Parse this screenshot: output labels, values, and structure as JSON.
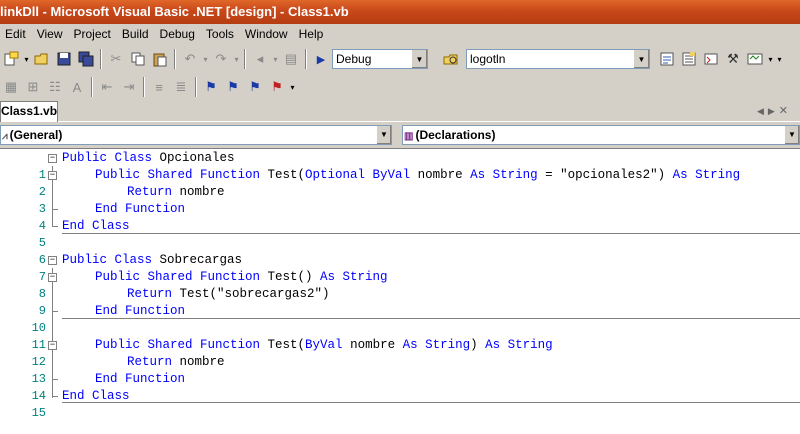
{
  "window": {
    "title": "linkDll - Microsoft Visual Basic .NET [design] - Class1.vb"
  },
  "menu": [
    "Edit",
    "View",
    "Project",
    "Build",
    "Debug",
    "Tools",
    "Window",
    "Help"
  ],
  "toolbar": {
    "config_value": "Debug",
    "find_value": "logotln"
  },
  "tab": {
    "label": "Class1.vb"
  },
  "dropdowns": {
    "class_value": "(General)",
    "method_value": "(Declarations)"
  },
  "code_lines": [
    {
      "n": "1",
      "kw1": "Public Class",
      "tx1": " Opcionales",
      "kw2": "",
      "tx2": "",
      "kw3": "",
      "tx3": "",
      "kw4": "",
      "tx4": "",
      "kw5": "",
      "tx5": "",
      "kw6": "",
      "tx6": ""
    },
    {
      "n": "2",
      "kw1": "Public Shared Function",
      "tx1": " Test(",
      "kw2": "Optional ByVal",
      "tx2": " nombre ",
      "kw3": "As String",
      "tx3": " = \"opcionales2\") ",
      "kw4": "As String",
      "tx4": "",
      "kw5": "",
      "tx5": "",
      "kw6": "",
      "tx6": ""
    },
    {
      "n": "3",
      "kw1": "Return",
      "tx1": " nombre",
      "kw2": "",
      "tx2": "",
      "kw3": "",
      "tx3": "",
      "kw4": "",
      "tx4": "",
      "kw5": "",
      "tx5": "",
      "kw6": "",
      "tx6": ""
    },
    {
      "n": "4",
      "kw1": "End Function",
      "tx1": "",
      "kw2": "",
      "tx2": "",
      "kw3": "",
      "tx3": "",
      "kw4": "",
      "tx4": "",
      "kw5": "",
      "tx5": "",
      "kw6": "",
      "tx6": ""
    },
    {
      "n": "5",
      "kw1": "End Class",
      "tx1": "",
      "kw2": "",
      "tx2": "",
      "kw3": "",
      "tx3": "",
      "kw4": "",
      "tx4": "",
      "kw5": "",
      "tx5": "",
      "kw6": "",
      "tx6": ""
    },
    {
      "n": "6",
      "kw1": "",
      "tx1": "",
      "kw2": "",
      "tx2": "",
      "kw3": "",
      "tx3": "",
      "kw4": "",
      "tx4": "",
      "kw5": "",
      "tx5": "",
      "kw6": "",
      "tx6": ""
    },
    {
      "n": "7",
      "kw1": "Public Class",
      "tx1": " Sobrecargas",
      "kw2": "",
      "tx2": "",
      "kw3": "",
      "tx3": "",
      "kw4": "",
      "tx4": "",
      "kw5": "",
      "tx5": "",
      "kw6": "",
      "tx6": ""
    },
    {
      "n": "8",
      "kw1": "Public Shared Function",
      "tx1": " Test() ",
      "kw2": "As String",
      "tx2": "",
      "kw3": "",
      "tx3": "",
      "kw4": "",
      "tx4": "",
      "kw5": "",
      "tx5": "",
      "kw6": "",
      "tx6": ""
    },
    {
      "n": "9",
      "kw1": "Return",
      "tx1": " Test(\"sobrecargas2\")",
      "kw2": "",
      "tx2": "",
      "kw3": "",
      "tx3": "",
      "kw4": "",
      "tx4": "",
      "kw5": "",
      "tx5": "",
      "kw6": "",
      "tx6": ""
    },
    {
      "n": "10",
      "kw1": "End Function",
      "tx1": "",
      "kw2": "",
      "tx2": "",
      "kw3": "",
      "tx3": "",
      "kw4": "",
      "tx4": "",
      "kw5": "",
      "tx5": "",
      "kw6": "",
      "tx6": ""
    },
    {
      "n": "11",
      "kw1": "",
      "tx1": "",
      "kw2": "",
      "tx2": "",
      "kw3": "",
      "tx3": "",
      "kw4": "",
      "tx4": "",
      "kw5": "",
      "tx5": "",
      "kw6": "",
      "tx6": ""
    },
    {
      "n": "12",
      "kw1": "Public Shared Function",
      "tx1": " Test(",
      "kw2": "ByVal",
      "tx2": " nombre ",
      "kw3": "As String",
      "tx3": ") ",
      "kw4": "As String",
      "tx4": "",
      "kw5": "",
      "tx5": "",
      "kw6": "",
      "tx6": ""
    },
    {
      "n": "13",
      "kw1": "Return",
      "tx1": " nombre",
      "kw2": "",
      "tx2": "",
      "kw3": "",
      "tx3": "",
      "kw4": "",
      "tx4": "",
      "kw5": "",
      "tx5": "",
      "kw6": "",
      "tx6": ""
    },
    {
      "n": "14",
      "kw1": "End Function",
      "tx1": "",
      "kw2": "",
      "tx2": "",
      "kw3": "",
      "tx3": "",
      "kw4": "",
      "tx4": "",
      "kw5": "",
      "tx5": "",
      "kw6": "",
      "tx6": ""
    },
    {
      "n": "15",
      "kw1": "End Class",
      "tx1": "",
      "kw2": "",
      "tx2": "",
      "kw3": "",
      "tx3": "",
      "kw4": "",
      "tx4": "",
      "kw5": "",
      "tx5": "",
      "kw6": "",
      "tx6": ""
    }
  ],
  "colors": {
    "keyword": "#0000ff",
    "line_number": "#008080",
    "titlebar": "#c8481a"
  }
}
